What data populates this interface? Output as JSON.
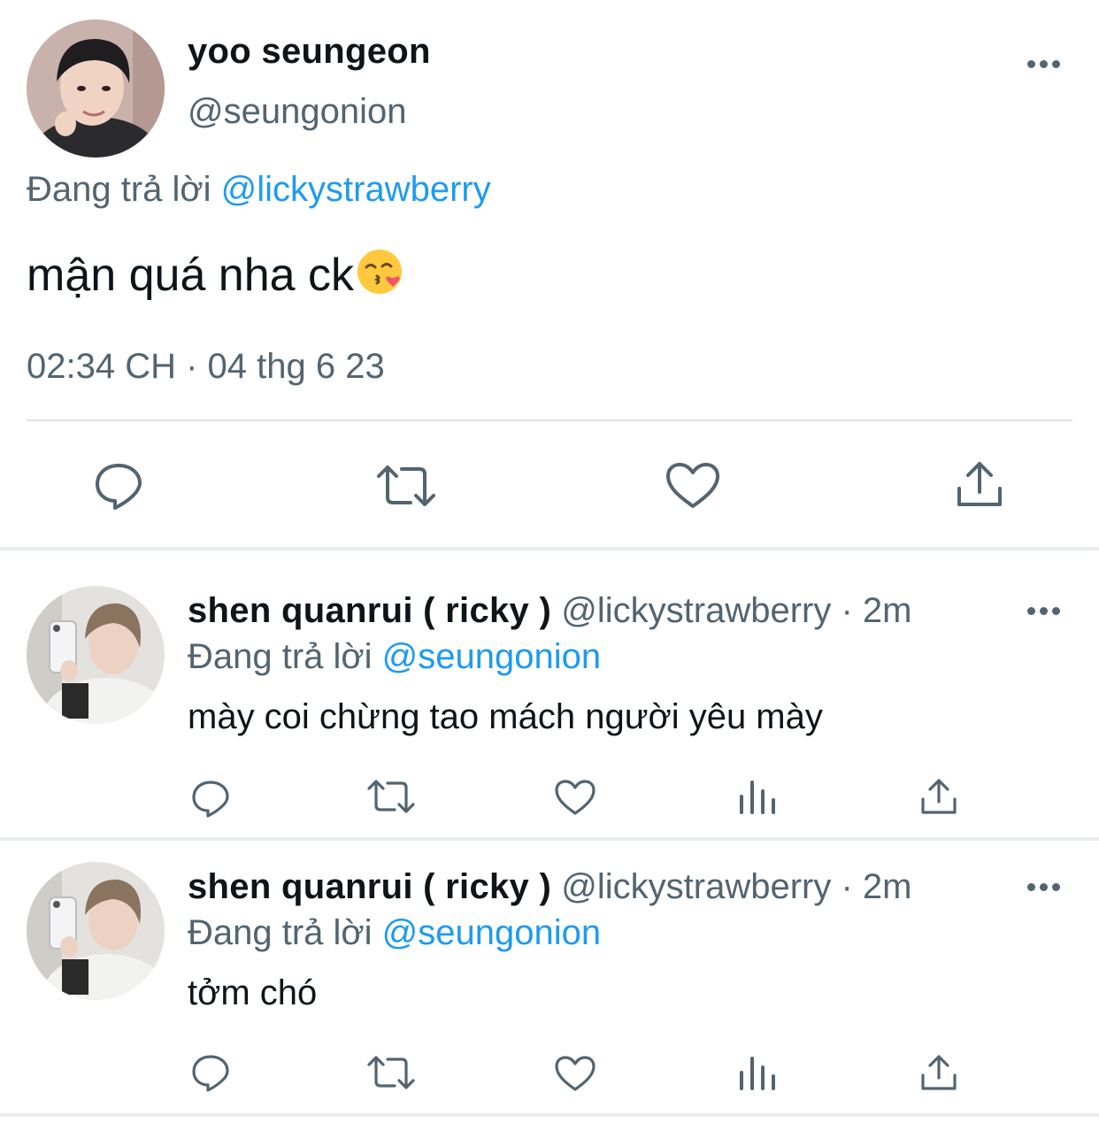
{
  "main_tweet": {
    "author_name": "yoo seungeon",
    "author_handle": "@seungonion",
    "reply_prefix": "Đang trả lời",
    "reply_mention": "@lickystrawberry",
    "text": "mận quá nha ck",
    "emoji": "face-blowing-kiss-emoji",
    "timestamp": "02:34 CH · 04 thg 6 23",
    "actions": [
      "reply-icon",
      "retweet-icon",
      "like-icon",
      "share-icon"
    ]
  },
  "replies": [
    {
      "author_name": "shen quanrui ( ricky )",
      "author_handle": "@lickystrawberry",
      "separator": "·",
      "time_ago": "2m",
      "reply_prefix": "Đang trả lời",
      "reply_mention": "@seungonion",
      "text": "mày coi chừng tao mách người yêu mày",
      "actions": [
        "reply-icon",
        "retweet-icon",
        "like-icon",
        "views-icon",
        "share-icon"
      ]
    },
    {
      "author_name": "shen quanrui ( ricky )",
      "author_handle": "@lickystrawberry",
      "separator": "·",
      "time_ago": "2m",
      "reply_prefix": "Đang trả lời",
      "reply_mention": "@seungonion",
      "text": "tởm chó",
      "actions": [
        "reply-icon",
        "retweet-icon",
        "like-icon",
        "views-icon",
        "share-icon"
      ]
    }
  ],
  "colors": {
    "text_primary": "#0f1419",
    "text_secondary": "#536471",
    "link": "#1d9bf0",
    "divider": "#e1e5e8"
  }
}
